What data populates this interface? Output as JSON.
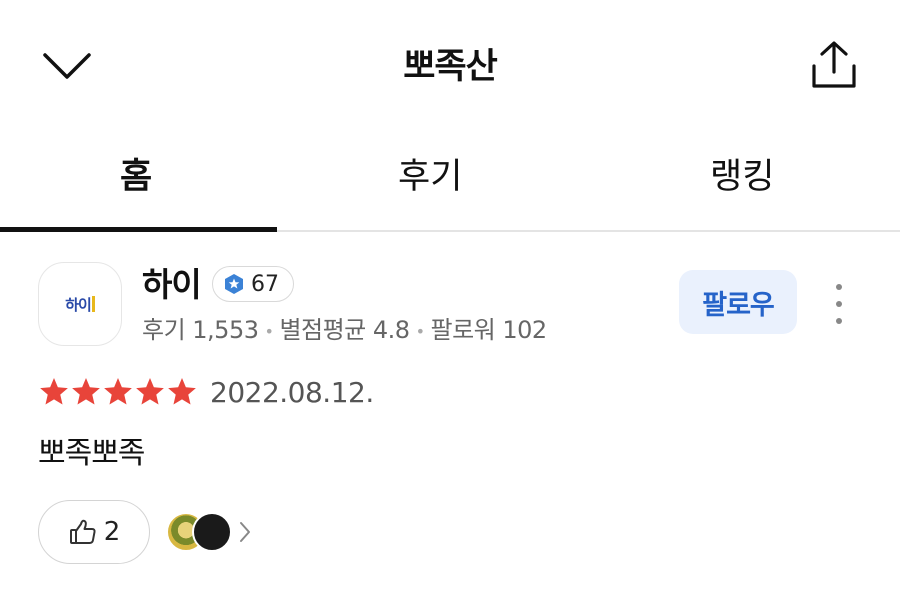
{
  "header": {
    "title": "뽀족산"
  },
  "tabs": [
    {
      "label": "홈",
      "active": true
    },
    {
      "label": "후기",
      "active": false
    },
    {
      "label": "랭킹",
      "active": false
    }
  ],
  "profile": {
    "logo_text": "하이",
    "nickname": "하이",
    "level": "67",
    "stats": {
      "reviews": "후기 1,553",
      "avg_rating": "별점평균 4.8",
      "followers": "팔로워 102"
    },
    "follow_label": "팔로우"
  },
  "review": {
    "rating": 5,
    "date": "2022.08.12.",
    "text": "뽀족뽀족",
    "like_count": "2"
  },
  "colors": {
    "star": "#e8443a",
    "follow_bg": "#eaf1fd",
    "follow_text": "#2563c9",
    "badge": "#3b82d6"
  },
  "icons": {
    "back": "chevron-down-icon",
    "share": "share-icon",
    "badge": "star-badge-icon",
    "like": "thumbs-up-icon",
    "more": "more-vertical-icon",
    "likers_chevron": "chevron-right-icon"
  }
}
